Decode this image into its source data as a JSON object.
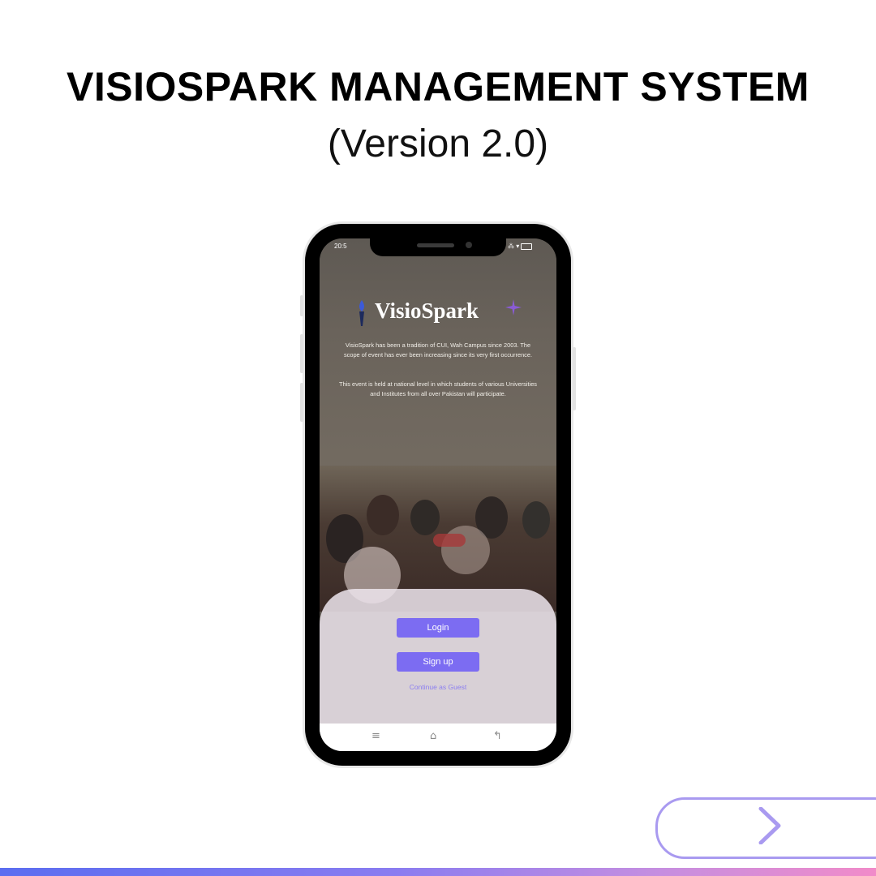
{
  "header": {
    "title": "VISIOSPARK MANAGEMENT SYSTEM",
    "subtitle": "(Version 2.0)"
  },
  "phone": {
    "status_time": "20:5",
    "app": {
      "logo_text": "VisioSpark",
      "description_p1": "VisioSpark has been a tradition of CUI, Wah Campus since 2003. The scope of event has ever been increasing since its very first occurrence.",
      "description_p2": "This event is held at national level in which students of various Universities and Institutes from all over Pakistan will participate.",
      "login_label": "Login",
      "signup_label": "Sign up",
      "guest_label": "Continue as Guest",
      "accent_color": "#7c6cf2"
    },
    "nav": {
      "menu_icon": "menu-icon",
      "home_icon": "home-icon",
      "back_icon": "back-icon"
    }
  },
  "colors": {
    "gradient_start": "#5b6df0",
    "gradient_end": "#f18bc9",
    "pill_border": "#a99af0"
  }
}
